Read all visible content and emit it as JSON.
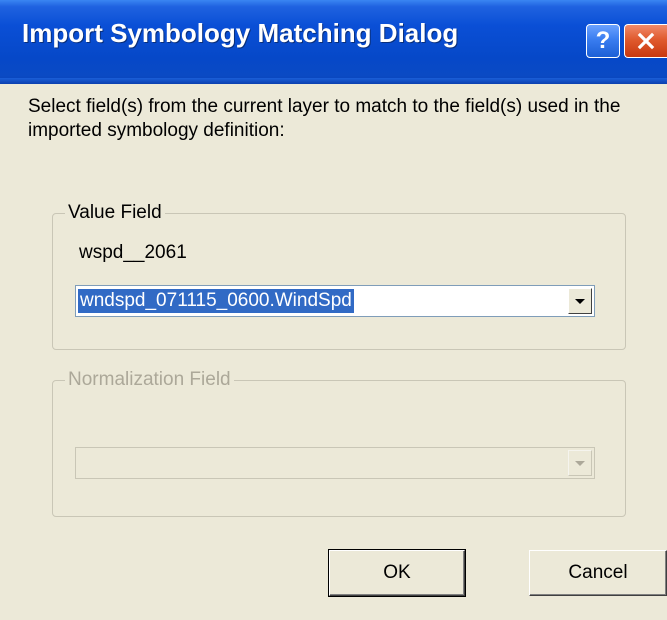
{
  "window": {
    "title": "Import Symbology Matching Dialog",
    "help_label": "?",
    "close_label": "✕"
  },
  "instruction": "Select field(s) from the current layer to match to the field(s) used in the imported symbology definition:",
  "value_field": {
    "legend": "Value Field",
    "source_field": "wspd__2061",
    "selected": "wndspd_071115_0600.WindSpd"
  },
  "normalization_field": {
    "legend": "Normalization Field",
    "selected": "",
    "enabled": false
  },
  "buttons": {
    "ok": "OK",
    "cancel": "Cancel"
  },
  "colors": {
    "titlebar": "#0a4fd6",
    "dialog_bg": "#ece9d8",
    "selection": "#316ac5",
    "close": "#e05a2e"
  }
}
